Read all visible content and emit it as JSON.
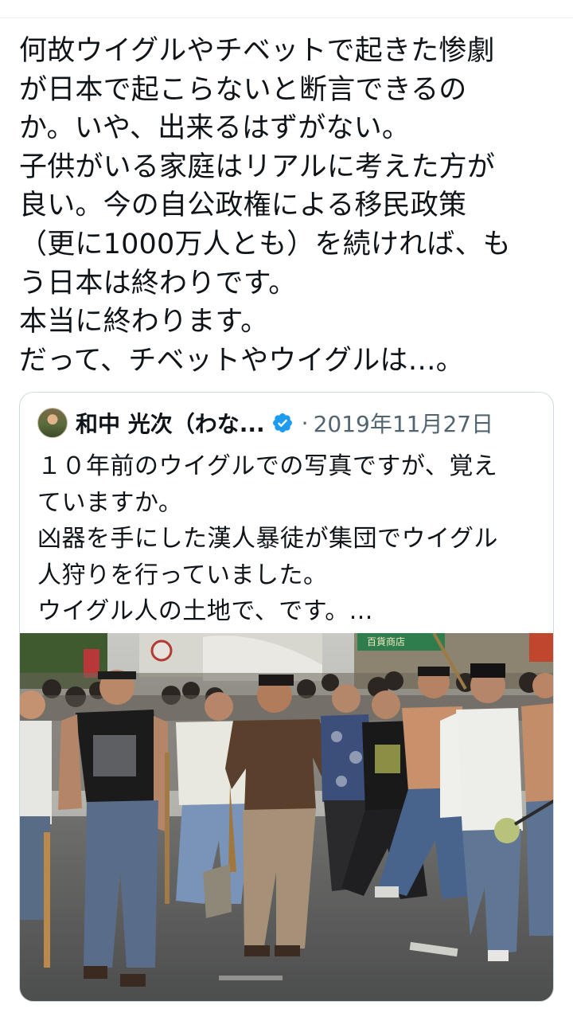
{
  "tweet": {
    "text": "何故ウイグルやチベットで起きた惨劇\nが日本で起こらないと断言できるの\nか。いや、出来るはずがない。\n子供がいる家庭はリアルに考えた方が\n良い。今の自公政権による移民政策\n（更に1000万人とも）を続ければ、も\nう日本は終わりです。\n本当に終わります。\nだって、チベットやウイグルは…。"
  },
  "quote": {
    "author_name": "和中 光次（わな...",
    "separator": "·",
    "date": "2019年11月27日",
    "text": "１０年前のウイグルでの写真ですが、覚え\nていますか。\n凶器を手にした漢人暴徒が集団でウイグル\n人狩りを行っていました。\nウイグル人の土地で、です。...",
    "photo_signs": [
      "百貨商店"
    ],
    "icons": {
      "verified": "verified-badge-icon",
      "avatar": "avatar-image"
    },
    "colors": {
      "verified": "#1d9bf0",
      "muted_text": "#536471",
      "border": "#cfd9de"
    }
  }
}
